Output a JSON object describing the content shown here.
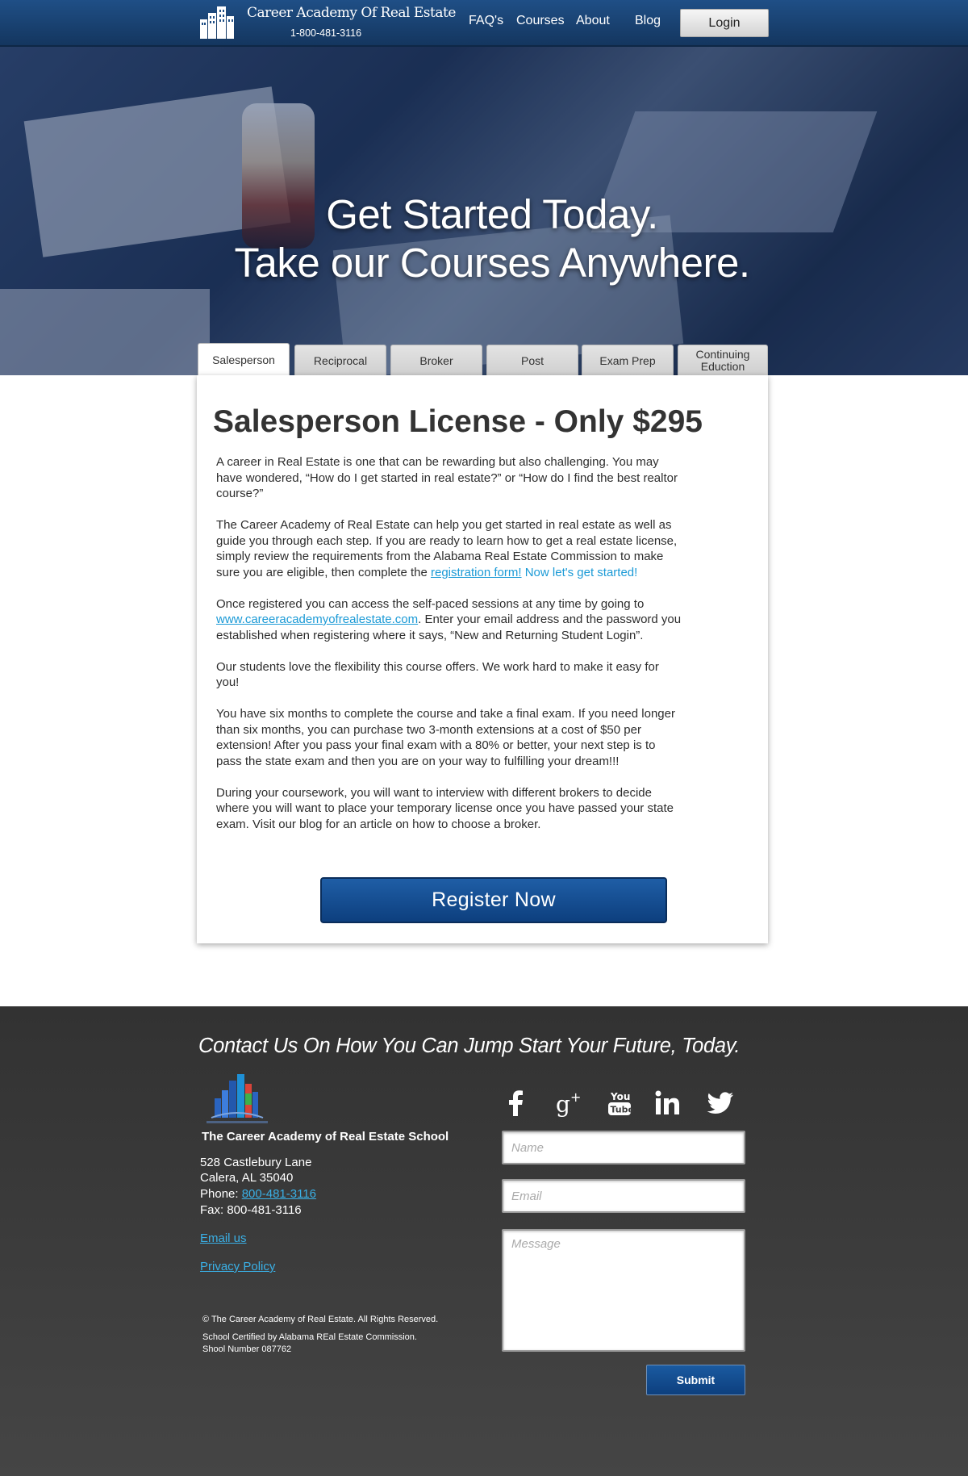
{
  "header": {
    "logo_name": "Career Academy Of Real Estate",
    "logo_phone": "1-800-481-3116",
    "nav": {
      "faq": "FAQ's",
      "courses": "Courses",
      "about": "About",
      "blog": "Blog"
    },
    "login_label": "Login"
  },
  "hero": {
    "line1": "Get Started Today.",
    "line2": "Take our Courses Anywhere."
  },
  "tabs": [
    {
      "label": "Salesperson",
      "active": true
    },
    {
      "label": "Reciprocal"
    },
    {
      "label": "Broker"
    },
    {
      "label": "Post"
    },
    {
      "label": "Exam Prep"
    },
    {
      "label": "Continuing Eduction"
    }
  ],
  "card": {
    "title": "Salesperson License - Only $295",
    "p1": "A career in Real Estate is one that can be rewarding but also challenging. You may have wondered, “How do I get started in real estate?” or “How do I find the best realtor course?”",
    "p2_a": "The Career Academy of Real Estate can help you get started in real estate as well as guide you through each step. If you are ready to learn how to get a real estate license, simply review the requirements from the Alabama Real Estate Commission to make sure you are eligible, then complete the ",
    "p2_link": "registration form!",
    "p2_b": " Now let's get started!",
    "p3_a": "Once registered you can access the self-paced sessions at any time by going to ",
    "p3_link": "www.careeracademyofrealestate.com",
    "p3_b": ". Enter your email address and the password you established when registering where it says, “New and Returning Student Login”.",
    "p4": "Our students love the flexibility this course offers. We work hard to make it easy for you!",
    "p5": "You have six months to complete the course and take a final exam. If you need longer than six months, you can purchase two 3-month extensions at a cost of $50 per extension! After you pass your final exam with a 80% or better, your next step is to pass the state exam and then you are on your way to fulfilling your dream!!!",
    "p6": "During your coursework, you will want to interview with different brokers to decide where you will want to place your temporary license once you have passed your state exam. Visit our blog for an article on how to choose a broker.",
    "register_label": "Register Now"
  },
  "footer": {
    "heading": "Contact Us On How You Can Jump Start Your Future, Today.",
    "school_name": "The Career Academy of Real Estate School",
    "address1": "528 Castlebury Lane",
    "address2": "Calera, AL 35040",
    "phone_prefix": "Phone: ",
    "phone_link": "800-481-3116",
    "fax": "Fax: 800-481-3116",
    "email_link": "Email us",
    "privacy_link": "Privacy Policy",
    "copyright": "© The Career Academy of Real Estate. All Rights Reserved.",
    "certified": "School Certified by Alabama REal Estate Commission.",
    "school_number": "Shool Number 087762",
    "social_icons": [
      "facebook-icon",
      "google-plus-icon",
      "youtube-icon",
      "linkedin-icon",
      "twitter-icon"
    ],
    "form": {
      "name_placeholder": "Name",
      "email_placeholder": "Email",
      "message_placeholder": "Message",
      "submit_label": "Submit"
    }
  },
  "colors": {
    "header_blue": "#1a4275",
    "link_blue": "#1b9ad6",
    "button_blue": "#0d3f7e",
    "footer_bg": "#3a3a3a"
  }
}
